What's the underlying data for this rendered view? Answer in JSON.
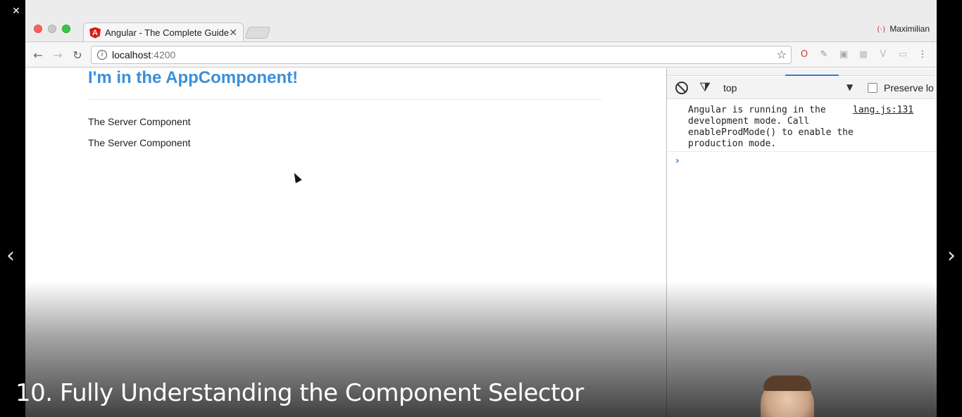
{
  "player": {
    "close_glyph": "✕",
    "restore_glyph": "❐",
    "minimize_glyph": "—",
    "prev_glyph": "‹",
    "next_glyph": "›",
    "lesson_title": "10. Fully Understanding the Component Selector"
  },
  "browser": {
    "tab": {
      "favicon_letter": "A",
      "title": "Angular - The Complete Guide",
      "close_glyph": "✕"
    },
    "profile": {
      "icon": "(·)",
      "name": "Maximilian"
    },
    "toolbar": {
      "back_glyph": "←",
      "forward_glyph": "→",
      "reload_glyph": "↻",
      "info_glyph": "i",
      "url_host": "localhost",
      "url_port": ":4200",
      "star_glyph": "☆",
      "extension_icons": [
        "opera-icon",
        "eyedropper-icon",
        "jsonview-icon",
        "grid-icon",
        "vue-icon",
        "cast-icon",
        "menu-icon"
      ],
      "extension_glyphs": [
        "O",
        "✎",
        "▣",
        "▦",
        "V",
        "▭",
        "⋮"
      ]
    }
  },
  "page": {
    "heading": "I'm in the AppComponent!",
    "server_components": [
      "The Server Component",
      "The Server Component"
    ]
  },
  "devtools": {
    "filter_glyph": "⧩",
    "context": "top",
    "dropdown_glyph": "▼",
    "preserve_log_label": "Preserve lo",
    "console_message": "Angular is running in the\ndevelopment mode. Call\nenableProdMode() to enable the\nproduction mode.",
    "console_source": "lang.js:131",
    "prompt_glyph": "›"
  },
  "colors": {
    "heading_blue": "#3b8fd9",
    "devtools_accent": "#3879d9",
    "close_red": "#fc605c",
    "maximize_green": "#34c84a"
  }
}
